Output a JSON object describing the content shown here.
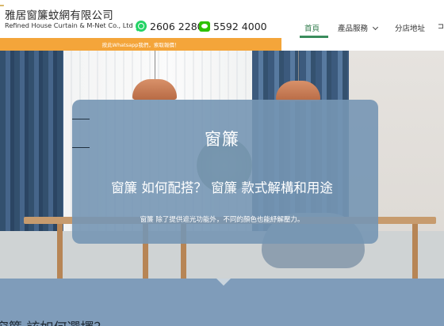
{
  "header": {
    "logo_cn": "雅居窗簾蚊網有限公司",
    "logo_en": "Refined House Curtain & M-Net Co., Ltd",
    "phone_whatsapp": "2606 2280",
    "phone_wechat": "5592 4000"
  },
  "nav": {
    "home": "首頁",
    "products": "產品服務",
    "branches": "分店地址",
    "more": "⊐"
  },
  "banner": {
    "text": "按此Whatsapp我們，索取報價！"
  },
  "hero": {
    "title": "窗簾",
    "subtitle": "窗簾 如何配搭？ 窗簾 款式解構和用途",
    "description": "窗簾 除了提供遮光功能外，不同的顏色也能紓解壓力。"
  },
  "lower": {
    "heading": "窗簾 該如何選擇？"
  },
  "colors": {
    "accent_green": "#3a8c5c",
    "banner_orange": "#f4a53a",
    "card_blue": "#7596b4",
    "panel_blue": "#7f9cba"
  },
  "icons": {
    "whatsapp": "whatsapp-icon",
    "wechat": "wechat-icon",
    "chevron": "chevron-down-icon"
  }
}
